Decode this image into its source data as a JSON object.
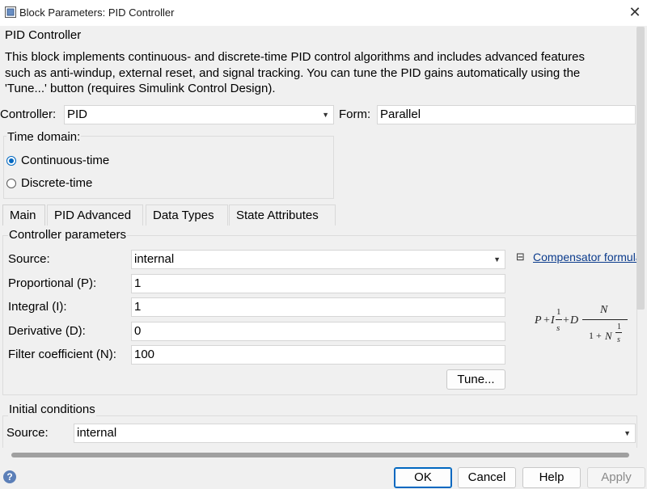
{
  "window": {
    "title": "Block Parameters: PID Controller",
    "close_icon": "close-icon"
  },
  "block": {
    "name": "PID Controller",
    "description_lines": [
      "This block implements continuous- and discrete-time PID control algorithms and includes advanced features",
      "such as anti-windup, external reset, and signal tracking. You can tune the PID gains automatically using the",
      "'Tune...' button (requires Simulink Control Design)."
    ]
  },
  "controller": {
    "label": "Controller:",
    "value": "PID",
    "form_label": "Form:",
    "form_value": "Parallel"
  },
  "time_domain": {
    "label": "Time domain:",
    "options": [
      {
        "label": "Continuous-time",
        "selected": true
      },
      {
        "label": "Discrete-time",
        "selected": false
      }
    ]
  },
  "tabs": [
    {
      "label": "Main",
      "active": true
    },
    {
      "label": "PID Advanced",
      "active": false
    },
    {
      "label": "Data Types",
      "active": false
    },
    {
      "label": "State Attributes",
      "active": false
    }
  ],
  "controller_parameters": {
    "heading": "Controller parameters",
    "source_label": "Source:",
    "source_value": "internal",
    "fields": [
      {
        "label": "Proportional (P):",
        "value": "1"
      },
      {
        "label": "Integral (I):",
        "value": "1"
      },
      {
        "label": "Derivative (D):",
        "value": "0"
      },
      {
        "label": "Filter coefficient (N):",
        "value": "100"
      }
    ],
    "tune_label": "Tune...",
    "compensator_toggle": "⊟",
    "compensator_link": "Compensator formula",
    "formula": {
      "P": "P",
      "plus1": "+",
      "I": "I",
      "one_a": "1",
      "s_a": "s",
      "plus2": "+",
      "D": "D",
      "N_top": "N",
      "one_plus": "1 +",
      "N_bot": "N",
      "one_b": "1",
      "s_b": "s"
    }
  },
  "initial_conditions": {
    "heading": "Initial conditions",
    "source_label": "Source:",
    "source_value": "internal"
  },
  "buttons": {
    "ok": "OK",
    "cancel": "Cancel",
    "help": "Help",
    "apply": "Apply"
  },
  "help_icon_glyph": "?",
  "colors": {
    "accent": "#0067c0",
    "link": "#0b3b8c",
    "background": "#f0f0f0"
  }
}
